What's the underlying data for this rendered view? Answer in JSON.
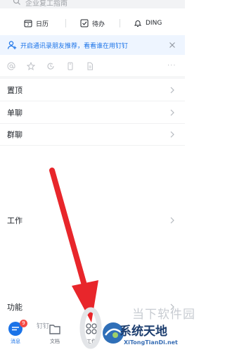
{
  "search": {
    "placeholder": "企业复工指南",
    "icon": "search-icon"
  },
  "quick_actions": [
    {
      "label": "日历",
      "icon": "calendar-icon"
    },
    {
      "label": "待办",
      "icon": "todo-check-icon"
    },
    {
      "label": "DING",
      "icon": "bell-icon"
    }
  ],
  "notice": {
    "text": "开启通讯录朋友推荐，看看谁在用钉钉",
    "icon": "user-add-icon",
    "accent": "#1a73e8"
  },
  "filters": [
    "at-icon",
    "star-icon",
    "clock-icon",
    "phone-icon",
    "document-icon",
    "more-icon"
  ],
  "filters_more": "···",
  "sections": {
    "pinned": "置顶",
    "single_chat": "单聊",
    "group_chat": "群聊",
    "work": "工作",
    "features": "功能"
  },
  "nav": {
    "messages": "消息",
    "messages_badge": "9",
    "docs": "文档",
    "peek_text": "钉钉",
    "work": "工作"
  },
  "watermark": {
    "line1": "当下软件园",
    "title": "系统天地",
    "subtitle": "XiTongTianDi.net"
  },
  "colors": {
    "brand": "#1a73e8",
    "badge": "#f54a45",
    "arrow": "#e8262b"
  }
}
